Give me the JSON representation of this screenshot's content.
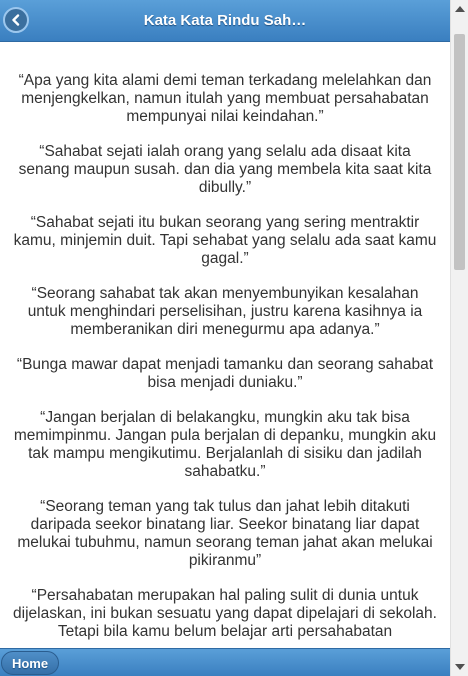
{
  "header": {
    "title": "Kata Kata Rindu Sah…",
    "back_icon": "chevron-left-icon"
  },
  "quotes": [
    "“Apa yang kita alami demi teman terkadang melelahkan dan menjengkelkan, namun itulah yang membuat persahabatan mempunyai nilai keindahan.”",
    "“Sahabat sejati ialah orang yang selalu ada disaat kita senang maupun susah. dan dia yang membela kita saat kita dibully.”",
    "“Sahabat sejati itu bukan seorang yang sering mentraktir kamu, minjemin duit. Tapi sehabat yang selalu ada saat kamu gagal.”",
    "“Seorang sahabat tak akan menyembunyikan kesalahan untuk menghindari perselisihan, justru karena kasihnya ia memberanikan diri menegurmu apa adanya.”",
    "“Bunga mawar dapat menjadi tamanku dan seorang sahabat bisa menjadi duniaku.”",
    "“Jangan berjalan di belakangku, mungkin aku tak bisa memimpinmu. Jangan pula berjalan di depanku, mungkin aku tak mampu mengikutimu. Berjalanlah di sisiku dan jadilah sahabatku.”",
    "“Seorang teman yang tak tulus dan jahat lebih ditakuti daripada seekor binatang liar. Seekor binatang liar dapat melukai tubuhmu, namun seorang teman jahat akan melukai pikiranmu”",
    "“Persahabatan merupakan hal paling sulit di dunia untuk dijelaskan, ini bukan sesuatu yang dapat dipelajari di sekolah. Tetapi bila kamu belum belajar arti persahabatan"
  ],
  "footer": {
    "home_label": "Home"
  },
  "colors": {
    "bar_top": "#5a9fd8",
    "bar_bottom": "#3a7fc0",
    "text": "#333333"
  }
}
